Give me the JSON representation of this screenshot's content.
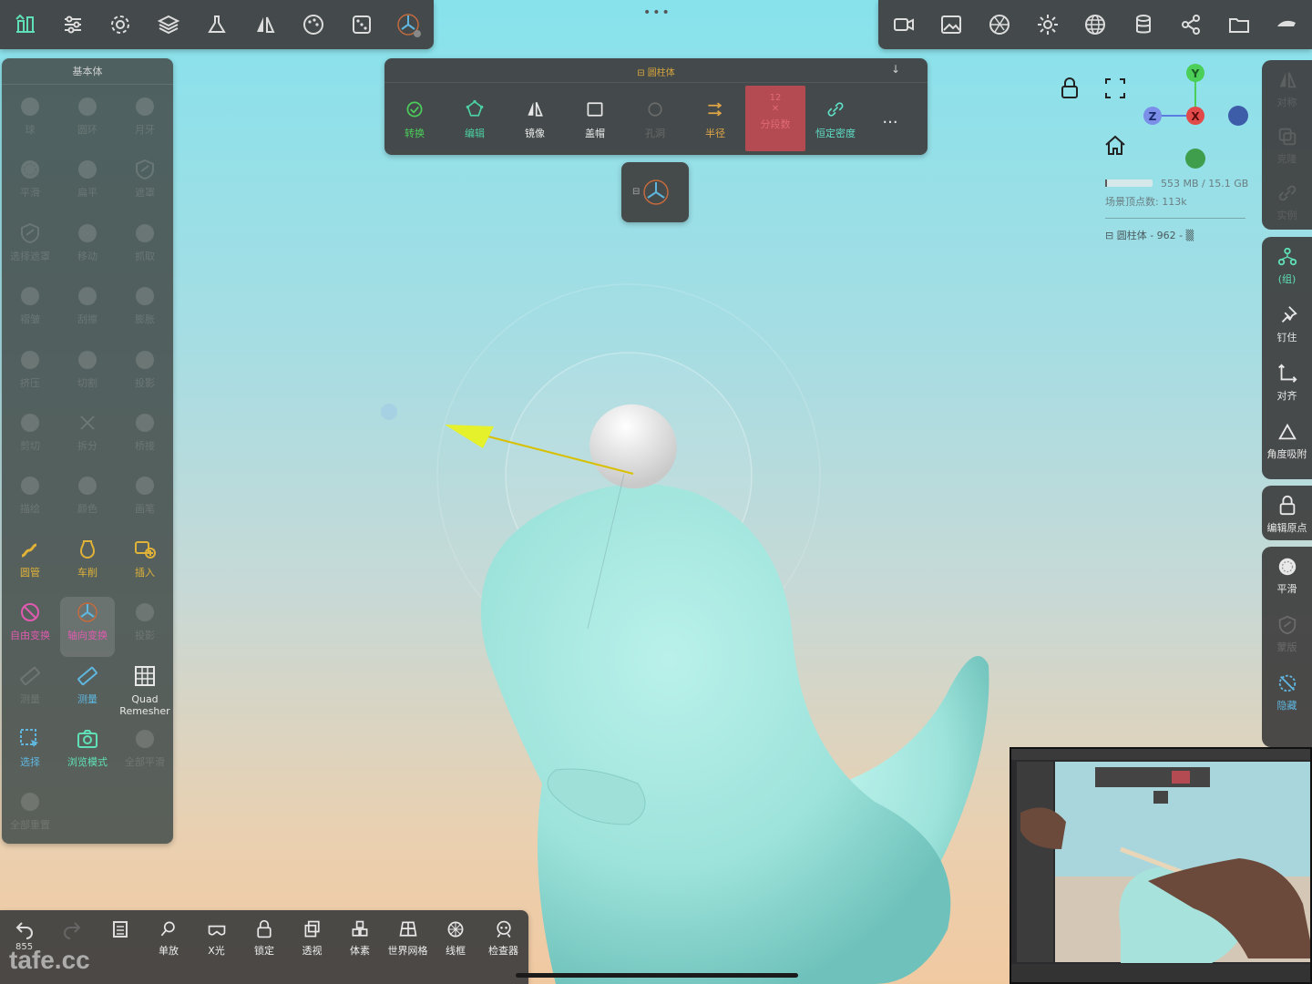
{
  "top_toolbar": {
    "left_icons": [
      "scene-icon",
      "settings-sliders-icon",
      "gear-icon",
      "layers-icon",
      "flask-icon",
      "mirror-icon",
      "palette-icon",
      "dice-icon",
      "gizmo-icon"
    ],
    "right_icons": [
      "camera-icon",
      "image-icon",
      "aperture-icon",
      "sun-icon",
      "sphere-grid-icon",
      "database-icon",
      "share-icon",
      "folder-icon",
      "hand-icon"
    ]
  },
  "left_panel": {
    "title": "基本体",
    "items": [
      {
        "label": "球",
        "icon": "sphere-icon",
        "dim": true
      },
      {
        "label": "圆环",
        "icon": "torus-icon",
        "dim": true
      },
      {
        "label": "月牙",
        "icon": "crescent-icon",
        "dim": true
      },
      {
        "label": "平滑",
        "icon": "smooth-icon",
        "dim": true
      },
      {
        "label": "扁平",
        "icon": "flatten-icon",
        "dim": true
      },
      {
        "label": "遮罩",
        "icon": "shield-icon",
        "dim": true
      },
      {
        "label": "选择遮罩",
        "icon": "shield-icon",
        "dim": true
      },
      {
        "label": "移动",
        "icon": "move-icon",
        "dim": true
      },
      {
        "label": "抓取",
        "icon": "hand-icon",
        "dim": true
      },
      {
        "label": "褶皱",
        "icon": "crease-icon",
        "dim": true
      },
      {
        "label": "刮擦",
        "icon": "scrape-icon",
        "dim": true
      },
      {
        "label": "膨胀",
        "icon": "inflate-icon",
        "dim": true
      },
      {
        "label": "挤压",
        "icon": "pinch-icon",
        "dim": true
      },
      {
        "label": "切割",
        "icon": "cut-icon",
        "dim": true
      },
      {
        "label": "投影",
        "icon": "project-icon",
        "dim": true
      },
      {
        "label": "剪切",
        "icon": "trim-icon",
        "dim": true
      },
      {
        "label": "拆分",
        "icon": "split-icon",
        "dim": true
      },
      {
        "label": "桥接",
        "icon": "bridge-icon",
        "dim": true
      },
      {
        "label": "描绘",
        "icon": "paint-icon",
        "dim": true
      },
      {
        "label": "颜色",
        "icon": "color-icon",
        "dim": true
      },
      {
        "label": "画笔",
        "icon": "brush-icon",
        "dim": true
      },
      {
        "label": "圆管",
        "icon": "tube-icon",
        "dim": false,
        "color": "#e0b237"
      },
      {
        "label": "车削",
        "icon": "lathe-icon",
        "dim": false,
        "color": "#e0b237"
      },
      {
        "label": "插入",
        "icon": "insert-icon",
        "dim": false,
        "color": "#e0b237"
      },
      {
        "label": "自由变换",
        "icon": "free-transform-icon",
        "dim": false,
        "color": "#e05bb0"
      },
      {
        "label": "轴向变换",
        "icon": "axis-transform-icon",
        "dim": false,
        "color": "#e05bb0",
        "selected": true
      },
      {
        "label": "投影",
        "icon": "projection-icon",
        "dim": true
      },
      {
        "label": "测量",
        "icon": "ruler-icon",
        "dim": true
      },
      {
        "label": "测量",
        "icon": "ruler-icon",
        "dim": false,
        "color": "#5fb7e0"
      },
      {
        "label": "Quad\nRemesher",
        "icon": "grid-icon",
        "dim": false,
        "color": "#e8e8e8"
      },
      {
        "label": "选择",
        "icon": "select-icon",
        "dim": false,
        "color": "#5fb7e0"
      },
      {
        "label": "浏览模式",
        "icon": "camera-icon",
        "dim": false,
        "color": "#5fe0b7"
      },
      {
        "label": "全部平滑",
        "icon": "smooth-all-icon",
        "dim": true
      },
      {
        "label": "全部重置",
        "icon": "reset-icon",
        "dim": true
      }
    ]
  },
  "tool_panel": {
    "title": "圆柱体",
    "items": [
      {
        "label": "转换",
        "color": "#4ccf59",
        "icon": "check-icon"
      },
      {
        "label": "编辑",
        "color": "#4ccfa2",
        "icon": "edit-icon"
      },
      {
        "label": "镜像",
        "color": "#e8e8e8",
        "icon": "mirror-icon"
      },
      {
        "label": "盖帽",
        "color": "#e8e8e8",
        "icon": "cap-icon"
      },
      {
        "label": "孔洞",
        "color": "#6a6a6a",
        "icon": "hole-icon"
      },
      {
        "label": "半径",
        "color": "#e0a646",
        "icon": "radius-icon"
      },
      {
        "label": "分段数",
        "color": "#e06a74",
        "icon": "split-icon",
        "value": "12"
      },
      {
        "label": "恒定密度",
        "color": "#5fe0c8",
        "icon": "link-icon"
      }
    ],
    "more": "..."
  },
  "status": {
    "memory": "553 MB / 15.1 GB",
    "memory_fraction": 0.04,
    "vertices": "场景顶点数: 113k",
    "object": "圆柱体 - 962 - ▒"
  },
  "axes": {
    "x": "X",
    "y": "Y",
    "z": "Z"
  },
  "right_sidebar": {
    "group1": [
      {
        "label": "对称",
        "icon": "mirror-icon",
        "dim": true
      },
      {
        "label": "克隆",
        "icon": "clone-icon",
        "dim": true
      },
      {
        "label": "实例",
        "icon": "link-icon",
        "dim": true
      }
    ],
    "group2": [
      {
        "label": "(组)",
        "icon": "group-icon",
        "color": "#5fe0b7"
      },
      {
        "label": "钉住",
        "icon": "pin-icon",
        "color": "#e8e8e8"
      },
      {
        "label": "对齐",
        "icon": "align-icon",
        "color": "#e8e8e8"
      },
      {
        "label": "角度吸附",
        "icon": "angle-icon",
        "color": "#e8e8e8"
      }
    ],
    "group3": [
      {
        "label": "编辑原点",
        "icon": "lock-icon",
        "color": "#e8e8e8"
      }
    ],
    "group4": [
      {
        "label": "平滑",
        "icon": "smooth-icon",
        "color": "#e8e8e8"
      },
      {
        "label": "蒙版",
        "icon": "shield-icon",
        "color": "#6a6a6a"
      },
      {
        "label": "隐藏",
        "icon": "hide-icon",
        "color": "#5fb7e0"
      }
    ]
  },
  "bottom_bar": {
    "undo_count": "855",
    "items": [
      {
        "label": "单放",
        "icon": "zoom-icon"
      },
      {
        "label": "X光",
        "icon": "xray-icon"
      },
      {
        "label": "锁定",
        "icon": "lock-icon"
      },
      {
        "label": "透视",
        "icon": "perspective-icon"
      },
      {
        "label": "体素",
        "icon": "voxel-icon"
      },
      {
        "label": "世界网格",
        "icon": "world-grid-icon"
      },
      {
        "label": "线框",
        "icon": "wireframe-icon"
      },
      {
        "label": "检查器",
        "icon": "inspector-icon"
      }
    ]
  },
  "watermark": "tafe.cc"
}
